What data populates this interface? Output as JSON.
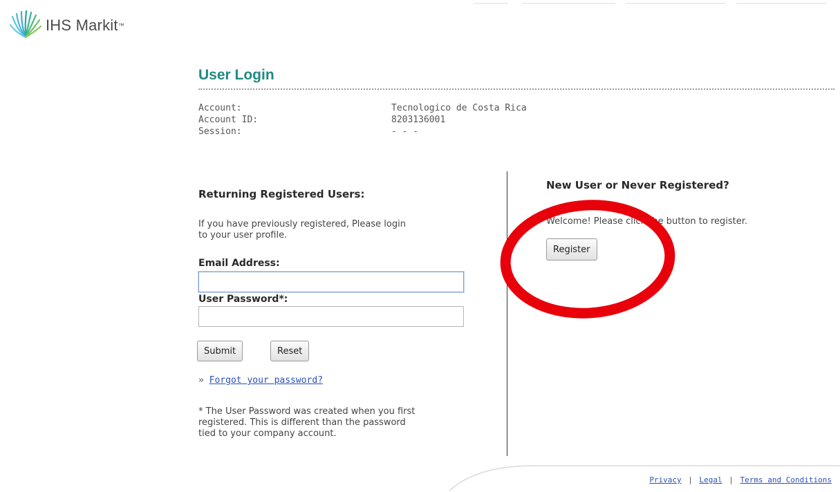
{
  "header": {
    "logo_text": "IHS Markit",
    "logo_tm": "™",
    "logo_icon": "ihs-markit-starburst-icon",
    "brand_color": "#1e8a83"
  },
  "page": {
    "title": "User Login"
  },
  "account_info": {
    "account_label": "Account:",
    "account_value": "Tecnologico de Costa Rica",
    "account_id_label": "Account ID:",
    "account_id_value": "8203136001",
    "session_label": "Session:",
    "session_value": "- - -"
  },
  "login": {
    "heading": "Returning Registered Users:",
    "intro_line1": "If you have previously registered, Please login",
    "intro_line2": "to your user profile.",
    "email_label": "Email Address:",
    "email_value": "",
    "password_label": "User Password*:",
    "password_value": "",
    "submit_label": "Submit",
    "reset_label": "Reset",
    "forgot_prefix": "»",
    "forgot_link": "Forgot your password?",
    "note_line1": "* The User Password was created when you first",
    "note_line2": "registered. This is different than the password",
    "note_line3": "tied to your company account."
  },
  "register": {
    "heading": "New User or Never Registered?",
    "welcome_text": "Welcome! Please click the button to register.",
    "register_label": "Register",
    "annotation_color": "#e8000b"
  },
  "footer": {
    "privacy": "Privacy",
    "legal": "Legal",
    "terms": "Terms and Conditions",
    "separator": "|"
  }
}
